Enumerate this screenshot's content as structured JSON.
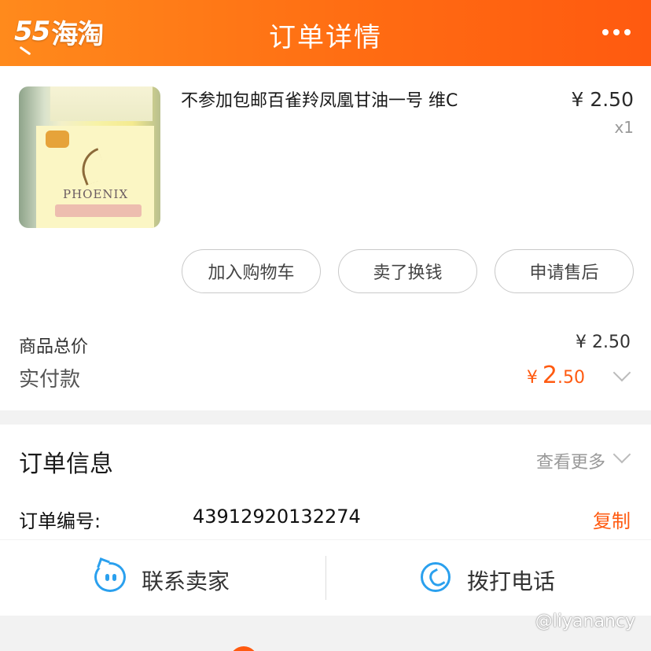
{
  "header": {
    "logo_num": "55",
    "logo_text": "海淘",
    "title": "订单详情"
  },
  "product": {
    "name": "不参加包邮百雀羚凤凰甘油一号  维C",
    "price": "¥ 2.50",
    "qty": "x1",
    "image_brand": "PHOENIX"
  },
  "actions": {
    "add_to_cart": "加入购物车",
    "sell": "卖了换钱",
    "after_sale": "申请售后"
  },
  "summary": {
    "total_label": "商品总价",
    "total_value": "¥ 2.50",
    "paid_label": "实付款",
    "paid_currency": "¥",
    "paid_int": "2",
    "paid_dec": ".50"
  },
  "order_info": {
    "title": "订单信息",
    "more": "查看更多",
    "number_label": "订单编号:",
    "number_value": "43912920132274",
    "copy": "复制"
  },
  "contact": {
    "seller": "联系卖家",
    "call": "拨打电话"
  },
  "watermark": "@liyanancy",
  "colors": {
    "header_start": "#ff8a1c",
    "header_end": "#ff5a10",
    "accent": "#ff5a10",
    "icon_blue": "#2aa0ee"
  }
}
